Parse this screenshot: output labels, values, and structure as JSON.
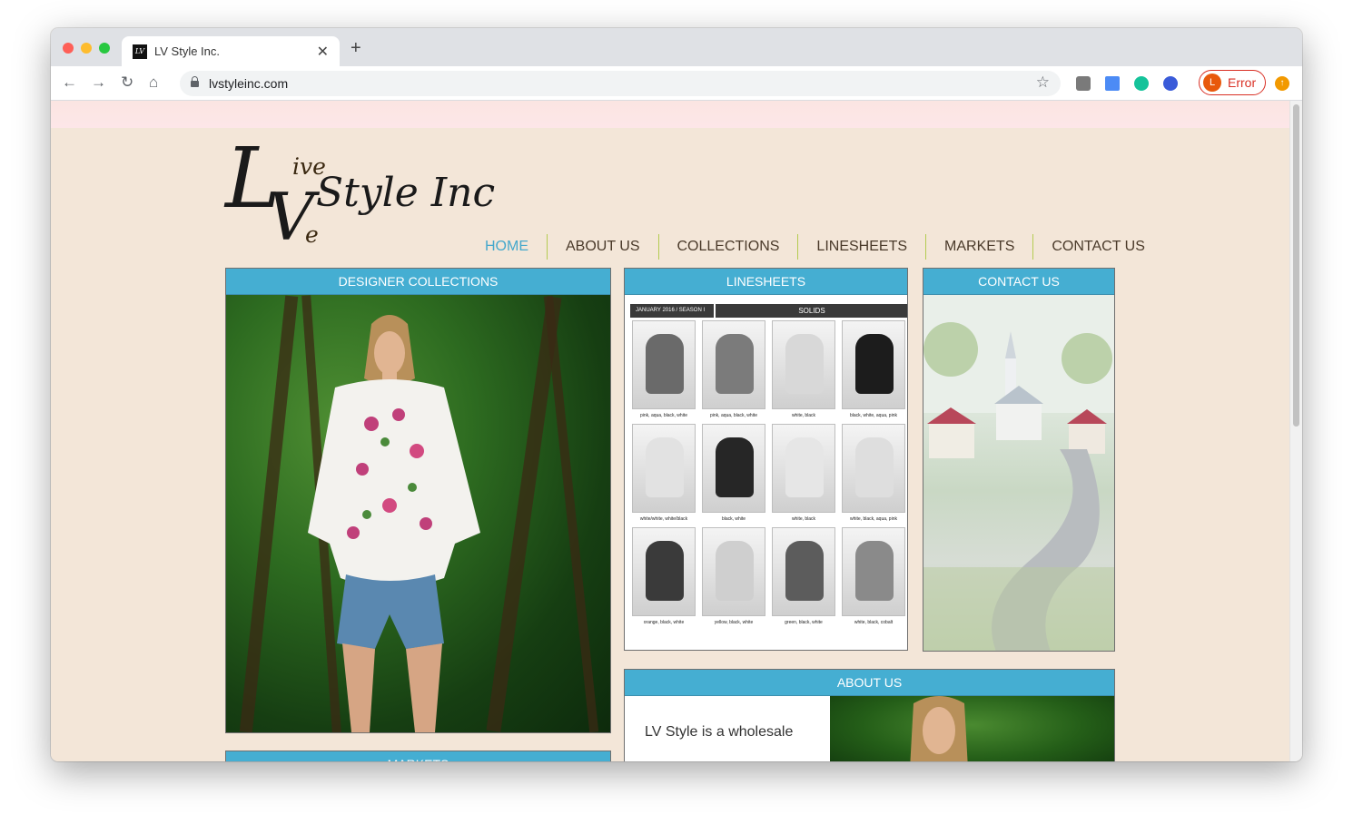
{
  "browser": {
    "tab_title": "LV Style Inc.",
    "url": "lvstyleinc.com",
    "profile_initial": "L",
    "profile_status": "Error"
  },
  "site": {
    "logo": {
      "letter_l": "L",
      "ive": "ive",
      "letter_v": "V",
      "e": "e",
      "style_inc": "Style Inc"
    },
    "nav": [
      "HOME",
      "ABOUT US",
      "COLLECTIONS",
      "LINESHEETS",
      "MARKETS",
      "CONTACT US"
    ],
    "active_nav": "HOME",
    "sections": {
      "designer_collections": "DESIGNER COLLECTIONS",
      "linesheets": "LINESHEETS",
      "contact_us": "CONTACT US",
      "about_us": "ABOUT US",
      "markets": "MARKETS"
    },
    "linesheet": {
      "season_label": "JANUARY 2016 / SEASON I",
      "title": "SOLIDS",
      "captions": [
        "pink, aqua, black, white",
        "pink, aqua, black, white",
        "white, black",
        "black, white, aqua, pink",
        "white/white, white/black",
        "black, white",
        "white, black",
        "white, black, aqua, pink",
        "orange, black, white",
        "yellow, black, white",
        "green, black, white",
        "white, black, cobalt"
      ],
      "tones": [
        "#6a6a6a",
        "#7b7b7b",
        "#d8d8d8",
        "#1c1c1c",
        "#e2e2e2",
        "#262626",
        "#e6e6e6",
        "#dedede",
        "#3a3a3a",
        "#cfcfcf",
        "#5c5c5c",
        "#8a8a8a"
      ]
    },
    "about_text": "LV Style is a wholesale"
  },
  "colors": {
    "accent": "#45aed2",
    "nav_active": "#45a8cc",
    "nav_divider": "#b4cc52",
    "page_bg": "#f3e6d8"
  }
}
